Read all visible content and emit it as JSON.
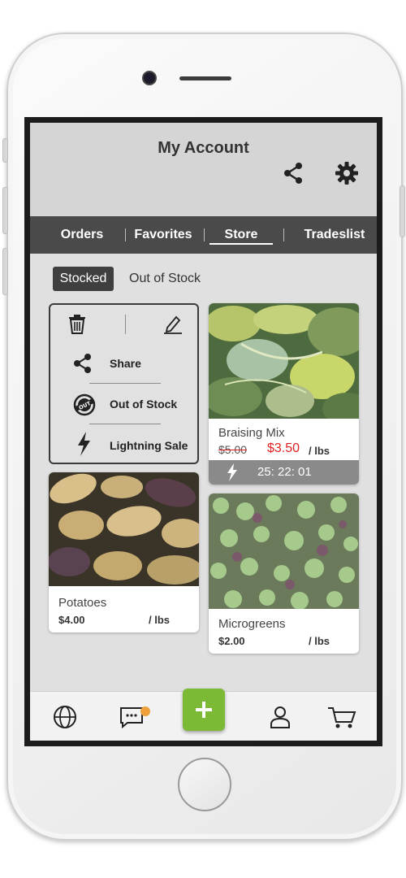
{
  "header": {
    "title": "My Account"
  },
  "tabs": {
    "items": [
      {
        "label": "Orders"
      },
      {
        "label": "Favorites"
      },
      {
        "label": "Store"
      },
      {
        "label": "Tradeslist"
      }
    ]
  },
  "subtabs": {
    "active": "Stocked",
    "inactive": "Out of Stock"
  },
  "action_menu": {
    "share": "Share",
    "out_of_stock": "Out of Stock",
    "lightning_sale": "Lightning Sale"
  },
  "products": [
    {
      "name": "Braising Mix",
      "old_price": "$5.00",
      "price": "$3.50",
      "unit": "/ lbs",
      "timer": "25: 22: 01"
    },
    {
      "name": "Potatoes",
      "price": "$4.00",
      "unit": "/ lbs"
    },
    {
      "name": "Microgreens",
      "price": "$2.00",
      "unit": "/ lbs"
    }
  ],
  "colors": {
    "accent": "#7cb934",
    "sale": "#e02020",
    "badge": "#f0a03a",
    "tabbar": "#4a4a4a"
  }
}
